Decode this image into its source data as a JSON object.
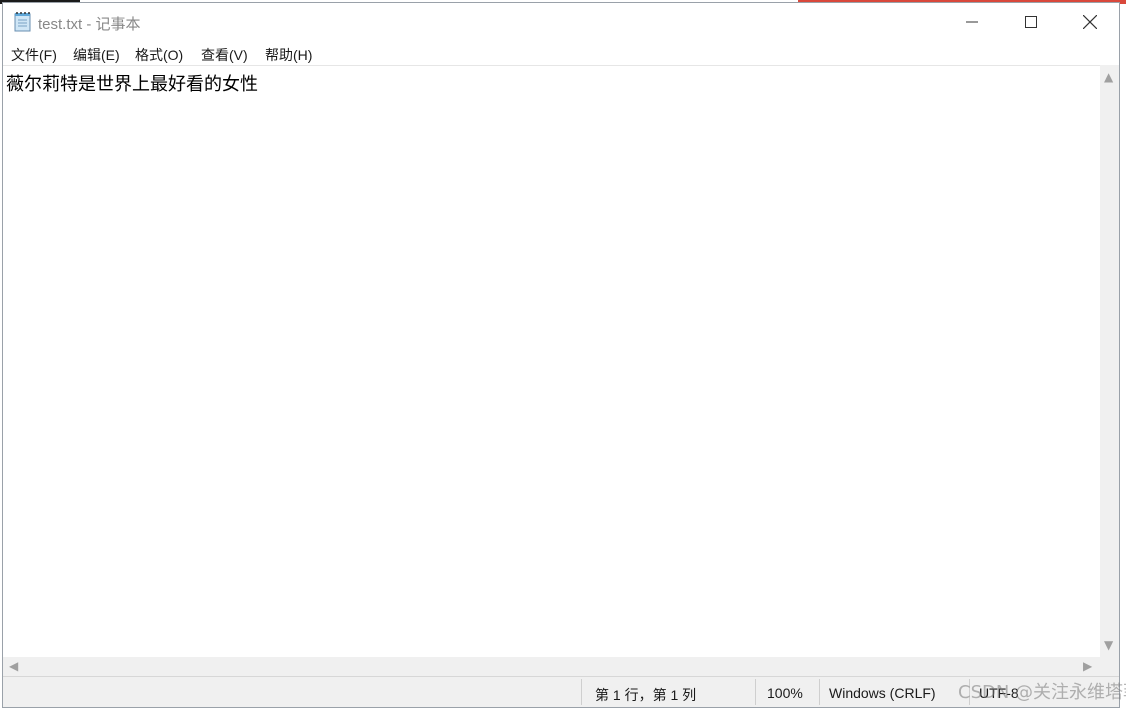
{
  "window": {
    "title": "test.txt - 记事本",
    "app_icon": "notepad-icon",
    "controls": {
      "minimize_icon": "minimize-icon",
      "maximize_icon": "maximize-icon",
      "close_icon": "close-icon"
    }
  },
  "menu": {
    "items": [
      {
        "label": "文件(F)"
      },
      {
        "label": "编辑(E)"
      },
      {
        "label": "格式(O)"
      },
      {
        "label": "查看(V)"
      },
      {
        "label": "帮助(H)"
      }
    ]
  },
  "editor": {
    "content": "薇尔莉特是世界上最好看的女性"
  },
  "statusbar": {
    "position": "第 1 行，第 1 列",
    "zoom": "100%",
    "line_ending": "Windows (CRLF)",
    "encoding": "UTF-8"
  },
  "watermark": {
    "text": "CSDN @关注永维塔菲喵"
  },
  "colors": {
    "title_text": "#888888",
    "status_bg": "#f0f0f0",
    "scrollbar_bg": "#f0f0f0",
    "background_accent": "#d9483b"
  }
}
